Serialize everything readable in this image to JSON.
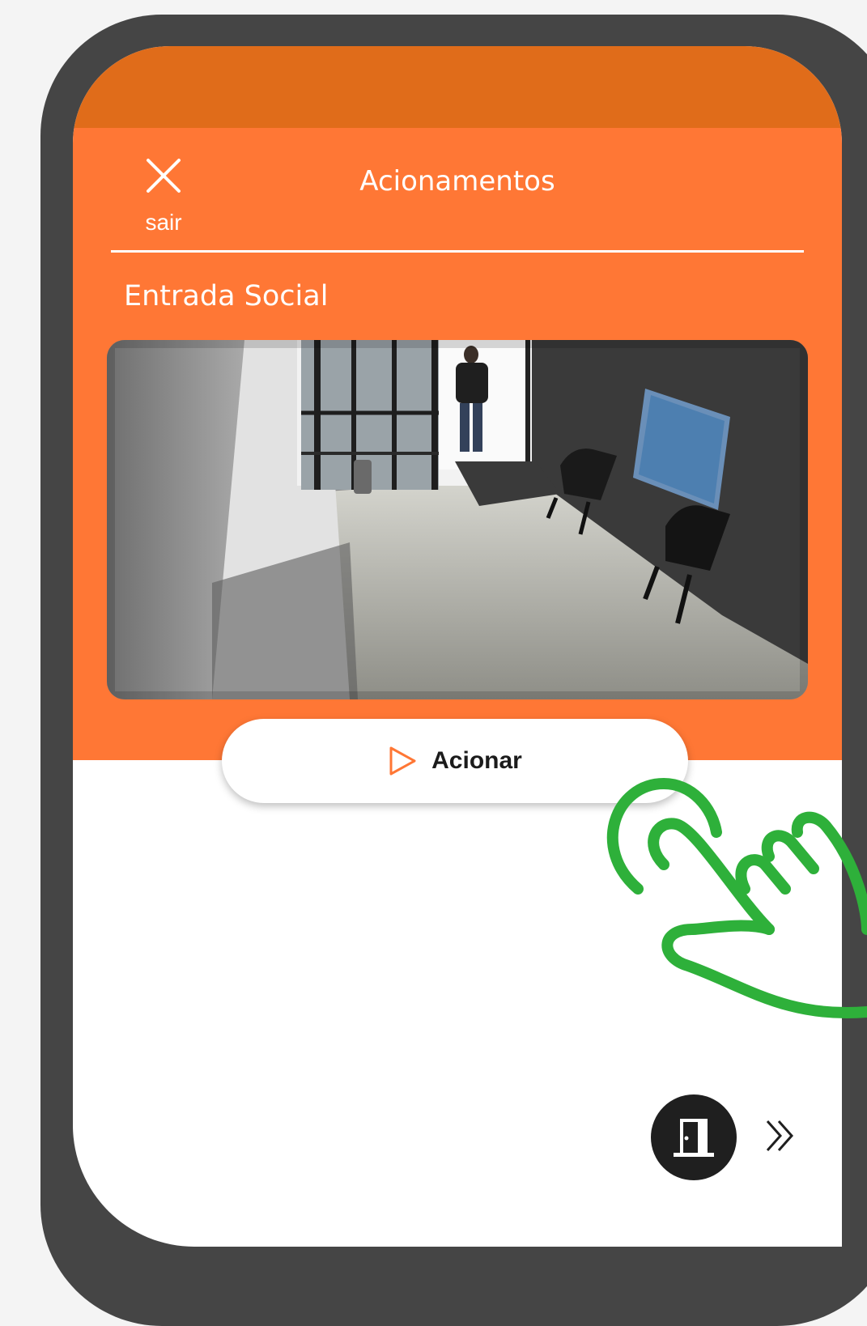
{
  "colors": {
    "status_bar": "#e06c1a",
    "header": "#ff7735",
    "frame": "#454545",
    "hand": "#2eb03a",
    "accent": "#ff7735"
  },
  "header": {
    "close_label": "sair",
    "title": "Acionamentos"
  },
  "section": {
    "title": "Entrada Social"
  },
  "action": {
    "label": "Acionar",
    "icon": "play-icon"
  },
  "footer": {
    "door_icon": "door-icon",
    "next_icon": "chevrons-right-icon"
  }
}
